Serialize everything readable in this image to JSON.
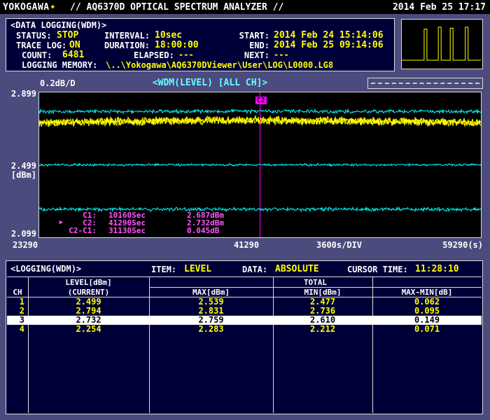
{
  "titlebar": {
    "logo": "YOKOGAWA",
    "diamond": "◆",
    "title": "// AQ6370D OPTICAL SPECTRUM ANALYZER //",
    "datetime": "2014 Feb 25 17:17"
  },
  "logging": {
    "header": "<DATA LOGGING(WDM)>",
    "status_label": "STATUS:",
    "status": "STOP",
    "interval_label": "INTERVAL:",
    "interval": "10sec",
    "start_label": "START:",
    "start": "2014 Feb 24 15:14:06",
    "trace_log_label": "TRACE LOG:",
    "trace_log": "ON",
    "duration_label": "DURATION:",
    "duration": "18:00:00",
    "end_label": "END:",
    "end": "2014 Feb 25 09:14:06",
    "count_label": "COUNT:",
    "count": "6481",
    "elapsed_label": "ELAPSED:",
    "elapsed": "---",
    "next_label": "NEXT:",
    "next": "---",
    "memory_label": "LOGGING MEMORY:",
    "memory": "\\..\\Yokogawa\\AQ6370DViewer\\User\\LOG\\L0000.LG8"
  },
  "chart": {
    "scale_label": "0.2dB/D",
    "title": "<WDM(LEVEL) [ALL CH]>",
    "y_top": "2.899",
    "y_mid": "2.499",
    "y_unit": "[dBm]",
    "y_bottom": "2.099",
    "x_left": "23290",
    "x_cursor": "41290",
    "x_div": "3600s/DIV",
    "x_right": "59290(s)",
    "cursor_label": "C2",
    "cursor_info": [
      {
        "arrow": "",
        "name": "C1:",
        "time": "10160Sec",
        "value": "2.687dBm"
      },
      {
        "arrow": "▶",
        "name": "C2:",
        "time": "41290Sec",
        "value": "2.732dBm"
      },
      {
        "arrow": "",
        "name": "C2-C1:",
        "time": "31130Sec",
        "value": "0.045dB"
      }
    ]
  },
  "chart_data": {
    "type": "line",
    "title": "<WDM(LEVEL) [ALL CH]>",
    "ylabel": "[dBm]",
    "scale_per_div": "0.2dB/D",
    "xlim": [
      23290,
      59290
    ],
    "ylim": [
      2.099,
      2.899
    ],
    "x_unit": "s",
    "x_div_seconds": 3600,
    "series": [
      {
        "name": "CH2",
        "color": "#00ffff",
        "level": 2.794,
        "noise": 0.012
      },
      {
        "name": "CH3",
        "color": "#ffff00",
        "level": 2.732,
        "noise": 0.026,
        "drift": 0.012
      },
      {
        "name": "CH1",
        "color": "#00ffff",
        "level": 2.499,
        "noise": 0.008
      },
      {
        "name": "CH4",
        "color": "#00ffff",
        "level": 2.254,
        "noise": 0.012
      }
    ],
    "cursor": {
      "label": "C2",
      "x": 41290,
      "color": "#ff00ff"
    },
    "markers": {
      "C1": {
        "time_s": 10160,
        "level_dbm": 2.687
      },
      "C2": {
        "time_s": 41290,
        "level_dbm": 2.732
      },
      "C2_minus_C1": {
        "time_s": 31130,
        "delta_db": 0.045
      }
    }
  },
  "preview": {
    "peaks": [
      {
        "x": 0.3,
        "h": 0.8
      },
      {
        "x": 0.48,
        "h": 0.84
      },
      {
        "x": 0.63,
        "h": 0.82
      },
      {
        "x": 0.82,
        "h": 0.84
      }
    ]
  },
  "table": {
    "header": "<LOGGING(WDM)>",
    "item_label": "ITEM:",
    "item": "LEVEL",
    "data_label": "DATA:",
    "data_value": "ABSOLUTE",
    "cursor_time_label": "CURSOR TIME:",
    "cursor_time": "11:28:10",
    "col_ch": "CH",
    "col_level_line1": "LEVEL[dBm]",
    "col_level_line2": "(CURRENT)",
    "col_total": "TOTAL",
    "col_max": "MAX[dBm]",
    "col_min": "MIN[dBm]",
    "col_maxmin": "MAX-MIN[dB]",
    "rows": [
      {
        "ch": "1",
        "current": "2.499",
        "max": "2.539",
        "min": "2.477",
        "maxmin": "0.062",
        "selected": false
      },
      {
        "ch": "2",
        "current": "2.794",
        "max": "2.831",
        "min": "2.736",
        "maxmin": "0.095",
        "selected": false
      },
      {
        "ch": "3",
        "current": "2.732",
        "max": "2.759",
        "min": "2.610",
        "maxmin": "0.149",
        "selected": true
      },
      {
        "ch": "4",
        "current": "2.254",
        "max": "2.283",
        "min": "2.212",
        "maxmin": "0.071",
        "selected": false
      }
    ]
  },
  "colors": {
    "background": "#4b4b7d",
    "panel": "#000038",
    "value_yellow": "#ffff00",
    "header_cyan": "#66ffff",
    "cursor_magenta": "#ff00ff",
    "trace_cyan": "#00ffff",
    "trace_yellow": "#ffff00",
    "highlight_row_bg": "#ffffff"
  }
}
